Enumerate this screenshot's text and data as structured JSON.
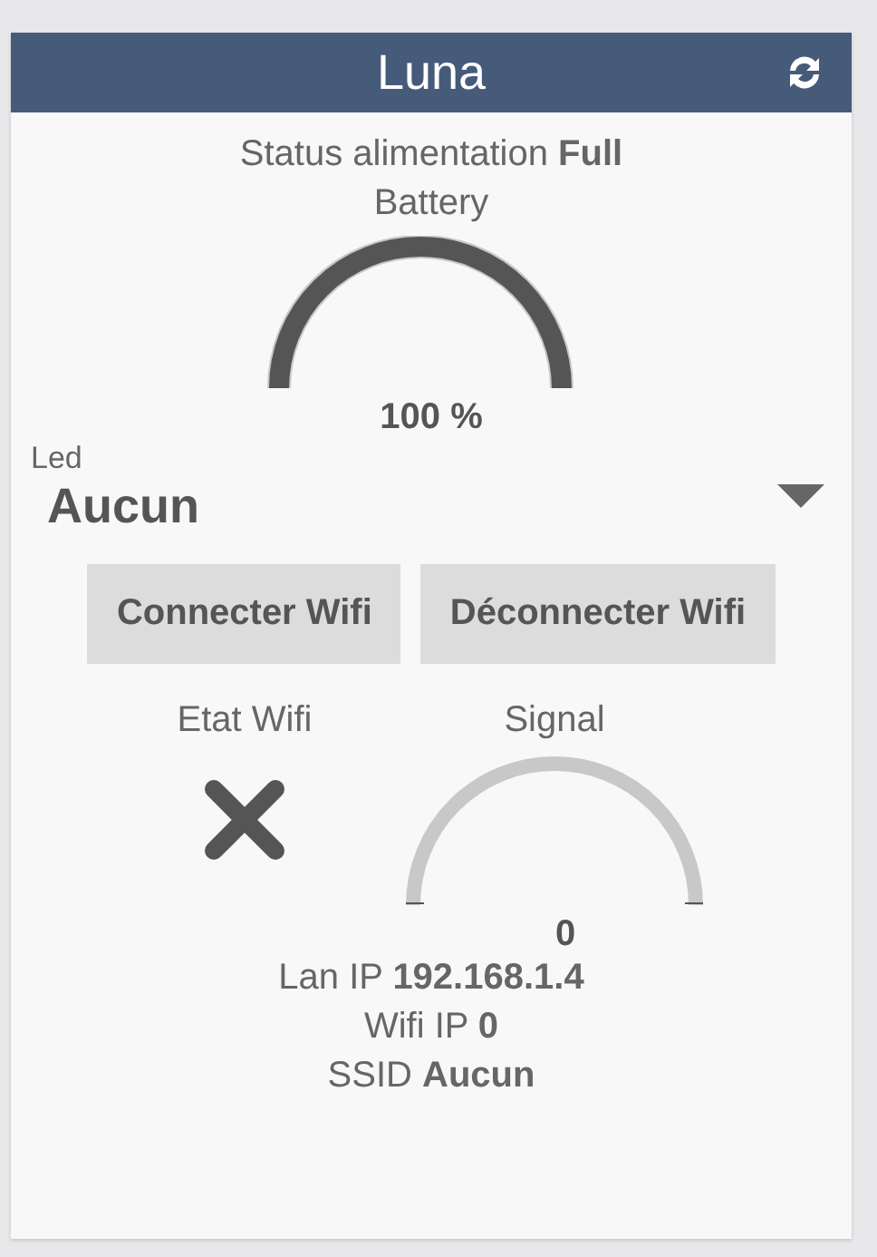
{
  "header": {
    "title": "Luna"
  },
  "power_status": "Status alimentation **Full**",
  "battery": {
    "label": "Battery",
    "reading": "100 %"
  },
  "led": {
    "label": "Led",
    "value": "Aucun"
  },
  "buttons": [
    "Connecter Wifi",
    "Déconnecter Wifi"
  ],
  "wifi_state": {
    "label": "Etat Wifi",
    "connected": false
  },
  "signal": {
    "label": "Signal",
    "reading": "0"
  },
  "info": [
    "Lan IP **192.168.1.4**",
    "Wifi IP **0**",
    "SSID **Aucun**"
  ]
}
